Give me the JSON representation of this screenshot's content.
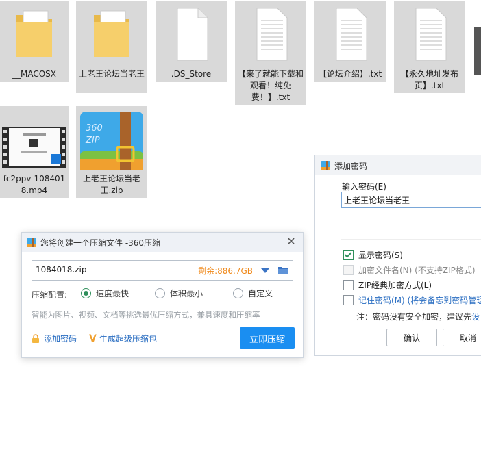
{
  "files": [
    {
      "label": "__MACOSX",
      "icon": "folder-icon"
    },
    {
      "label": "上老王论坛当老王",
      "icon": "folder-icon"
    },
    {
      "label": ".DS_Store",
      "icon": "blank-file-icon"
    },
    {
      "label": "【来了就能下载和观看！纯免费！】.txt",
      "icon": "text-file-icon"
    },
    {
      "label": "【论坛介绍】.txt",
      "icon": "text-file-icon"
    },
    {
      "label": "【永久地址发布页】.txt",
      "icon": "text-file-icon"
    },
    {
      "label": "fc2ppv-1084018.mp4",
      "icon": "video-file-icon"
    },
    {
      "label": "上老王论坛当老王.zip",
      "icon": "zip-archive-icon"
    }
  ],
  "compress_dialog": {
    "title": "您将创建一个压缩文件 -360压缩",
    "filename": "1084018.zip",
    "free_space": "剩余:886.7GB",
    "config_label": "压缩配置:",
    "options": [
      "速度最快",
      "体积最小",
      "自定义"
    ],
    "selected_option": "速度最快",
    "hint": "智能为图片、视频、文档等挑选最优压缩方式，兼具速度和压缩率",
    "add_password": "添加密码",
    "make_sfx": "生成超级压缩包",
    "compress_now": "立即压缩"
  },
  "password_dialog": {
    "title": "添加密码",
    "input_label": "输入密码(E)",
    "password_value": "上老王论坛当老王",
    "checkboxes": [
      {
        "label": "显示密码(S)",
        "checked": true,
        "enabled": true
      },
      {
        "label": "加密文件名(N) (不支持ZIP格式)",
        "checked": false,
        "enabled": false
      },
      {
        "label": "ZIP经典加密方式(L)",
        "checked": false,
        "enabled": true
      },
      {
        "label": "记住密码(M) (将会备忘到密码管理",
        "checked": false,
        "enabled": true
      }
    ],
    "note_prefix": "注：密码没有安全加密，建议先",
    "note_link": "设",
    "ok": "确认",
    "cancel": "取消"
  },
  "colors": {
    "accent": "#1a8ef1",
    "link": "#2a6ec2",
    "warning": "#f08a1c",
    "check": "#2f8f5b"
  }
}
